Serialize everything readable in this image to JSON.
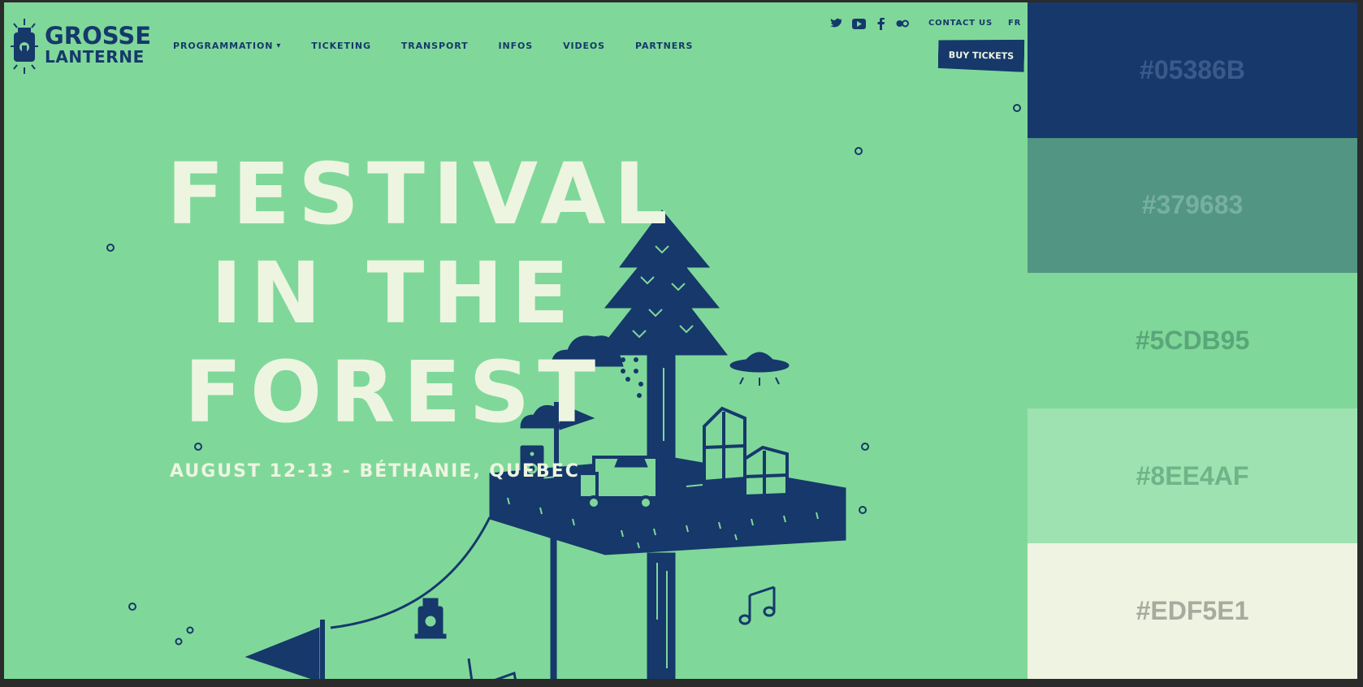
{
  "header": {
    "logo": {
      "line1": "GROSSE",
      "line2": "LANTERNE",
      "icon": "lantern-icon"
    },
    "nav": [
      {
        "label": "PROGRAMMATION",
        "dropdown": true
      },
      {
        "label": "TICKETING"
      },
      {
        "label": "TRANSPORT"
      },
      {
        "label": "INFOS"
      },
      {
        "label": "VIDEOS"
      },
      {
        "label": "PARTNERS"
      }
    ],
    "social_icons": [
      "twitter-icon",
      "youtube-icon",
      "facebook-icon",
      "flickr-icon"
    ],
    "contact_label": "CONTACT US",
    "language_label": "FR",
    "buy_label": "BUY TICKETS"
  },
  "hero": {
    "title_lines": [
      "FESTIVAL",
      "IN THE",
      "FOREST"
    ],
    "subtitle": "AUGUST 12-13 - BÉTHANIE, QUEBEC",
    "illustration": "floating-forest-island"
  },
  "palette": [
    {
      "hex": "#05386B",
      "bg": "#16386b",
      "text": "#3a5a8a"
    },
    {
      "hex": "#379683",
      "bg": "#529582",
      "text": "#77b0a0"
    },
    {
      "hex": "#5CDB95",
      "bg": "#7fd899",
      "text": "#5aa57a"
    },
    {
      "hex": "#8EE4AF",
      "bg": "#9ee2b1",
      "text": "#6fb388"
    },
    {
      "hex": "#EDF5E1",
      "bg": "#eef3e2",
      "text": "#a7ab9e"
    }
  ]
}
